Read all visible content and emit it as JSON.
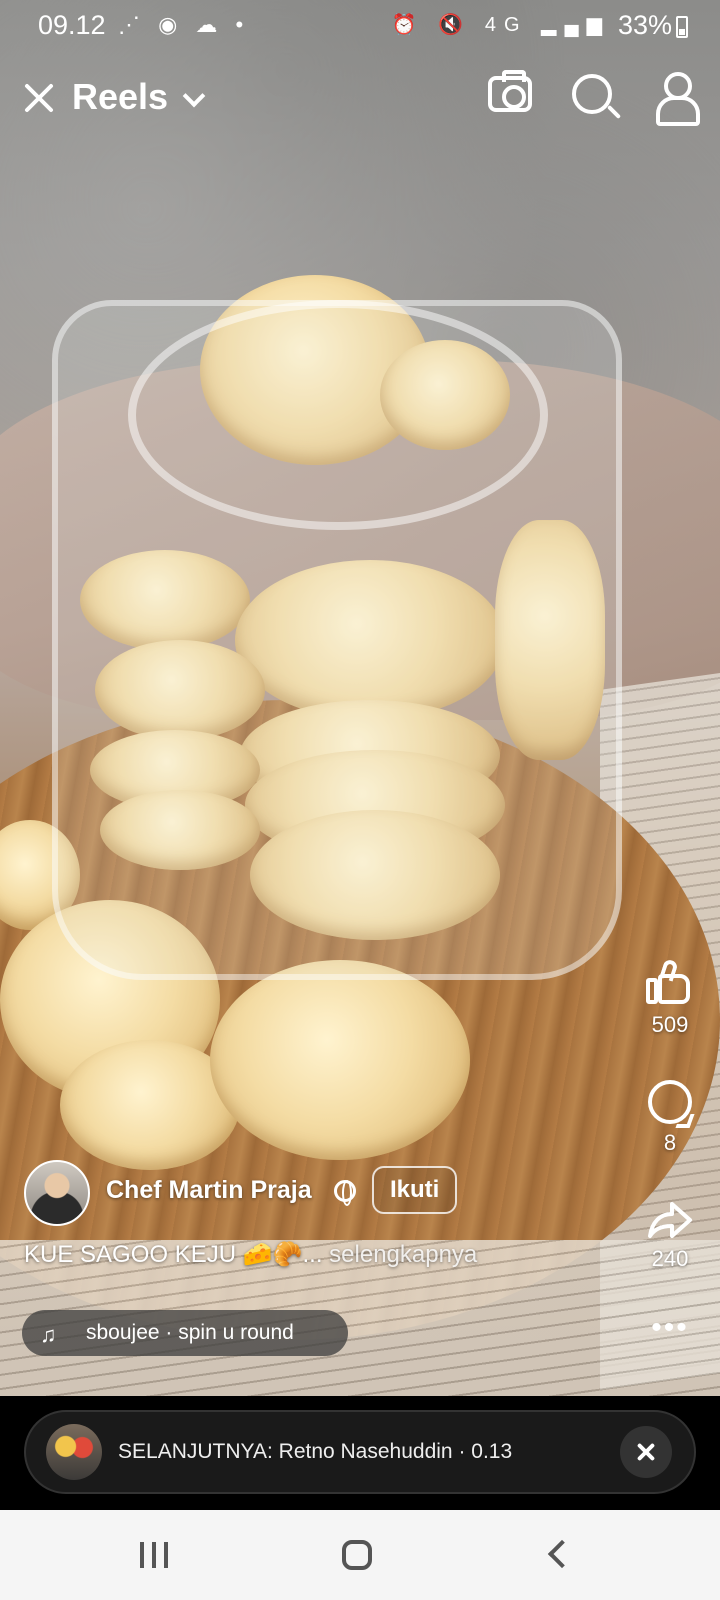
{
  "status_bar": {
    "time": "09.12",
    "left_icons": "⋰ ◉ ☁ •",
    "right_icons": "⏰ 🔇 4G ▂▄▆",
    "battery": "33%"
  },
  "header": {
    "title": "Reels"
  },
  "reel": {
    "author": "Chef Martin Praja",
    "follow_label": "Ikuti",
    "caption": "KUE SAGOO KEJU 🧀🥐...",
    "caption_more": " selengkapnya",
    "music": "sboujee · spin u round",
    "likes": "509",
    "comments": "8",
    "shares": "240",
    "more": "•••"
  },
  "up_next": {
    "text": "SELANJUTNYA: Retno Nasehuddin · 0.13"
  },
  "icons": {
    "close": "close-icon",
    "chevron": "chevron-down-icon",
    "camera": "camera-icon",
    "search": "search-icon",
    "profile": "profile-icon",
    "like": "thumbs-up-icon",
    "comment": "comment-icon",
    "share": "share-icon",
    "music": "music-note-icon",
    "globe": "globe-icon"
  }
}
